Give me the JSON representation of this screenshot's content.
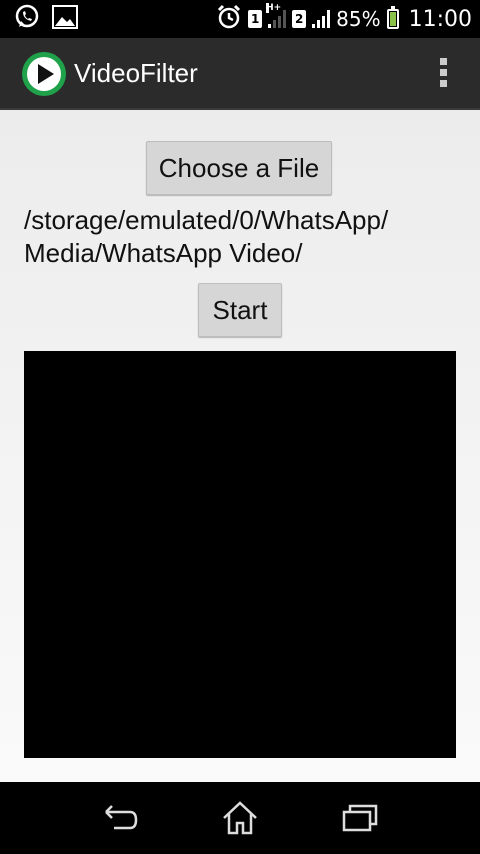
{
  "status_bar": {
    "sim1": "1",
    "sim2": "2",
    "network_type": "H+",
    "battery_percent": "85%",
    "battery_level": 0.85,
    "time": "11:00",
    "icons": [
      "whatsapp-icon",
      "image-icon",
      "alarm-icon"
    ]
  },
  "action_bar": {
    "title": "VideoFilter",
    "logo_color": "#1fa24a"
  },
  "main": {
    "choose_button_label": "Choose a File",
    "file_path": "/storage/emulated/0/WhatsApp/ Media/WhatsApp Video/",
    "start_button_label": "Start"
  }
}
